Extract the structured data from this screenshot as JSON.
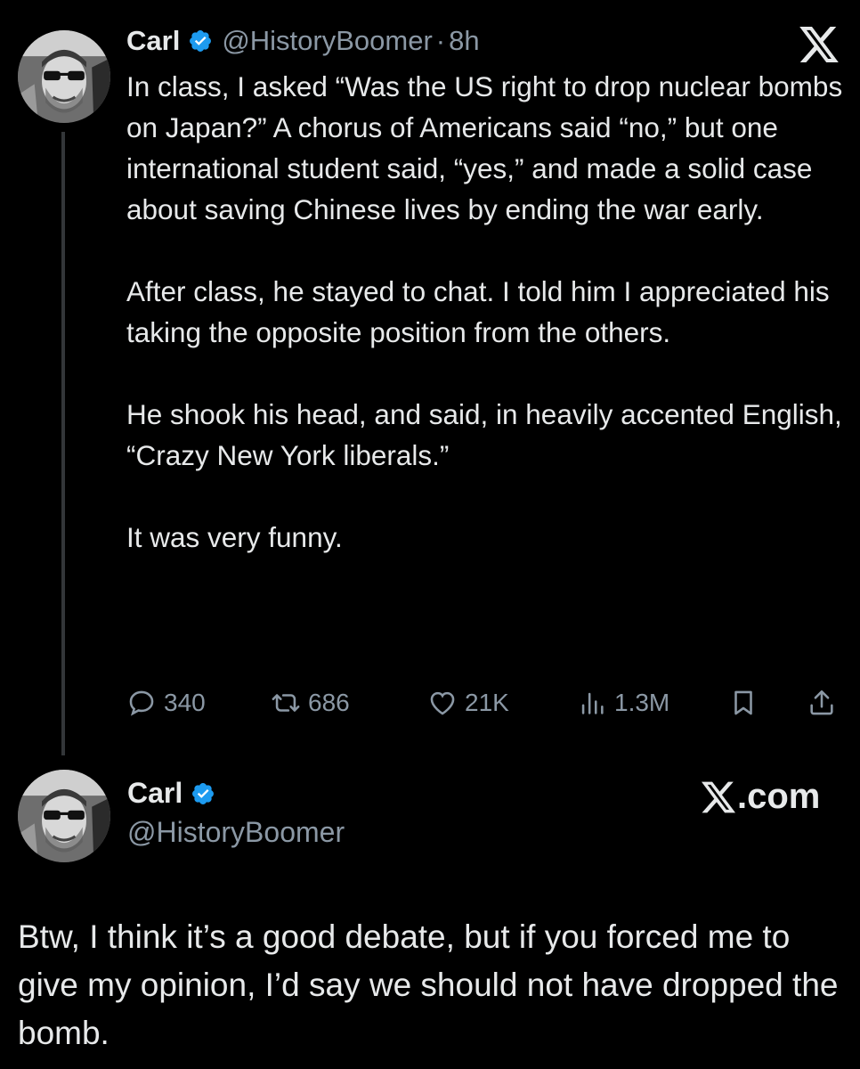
{
  "tweet": {
    "author_name": "Carl",
    "author_handle": "@HistoryBoomer",
    "separator": "·",
    "time": "8h",
    "paragraphs": [
      "In class, I asked “Was the US right to drop nuclear bombs on Japan?” A chorus of Americans said “no,” but one international student said, “yes,” and made a solid case about saving Chinese lives by ending the war early.",
      "After class, he stayed to chat. I told him I appreciated his taking the opposite position from the others.",
      "He shook his head, and said, in heavily accented English,\n“Crazy New York liberals.”",
      "It was very funny."
    ],
    "actions": {
      "replies": "340",
      "reposts": "686",
      "likes": "21K",
      "views": "1.3M"
    },
    "icons": {
      "reply": "comment-bubble-icon",
      "repost": "repost-arrows-icon",
      "like": "heart-icon",
      "views": "bar-chart-icon",
      "bookmark": "bookmark-icon",
      "share": "share-upload-icon",
      "brand": "x-logo-icon",
      "verified": "verified-badge-icon"
    }
  },
  "reply": {
    "author_name": "Carl",
    "author_handle": "@HistoryBoomer",
    "brand_label": ".com",
    "text": "Btw, I think it’s a good debate, but if you forced me to give my opinion, I’d say we should not have dropped the bomb."
  },
  "colors": {
    "background": "#000000",
    "text": "#e7e9ea",
    "secondary_text": "#8b98a5",
    "verified_blue": "#1d9bf0",
    "thread_line": "#333639"
  }
}
